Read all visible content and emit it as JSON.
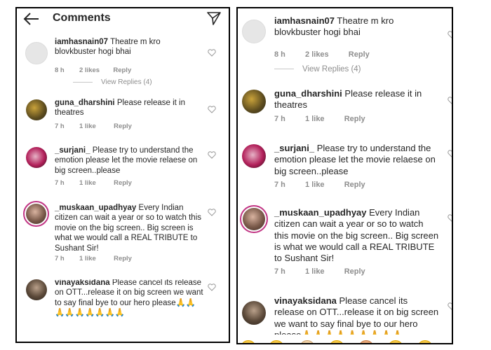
{
  "header": {
    "title": "Comments",
    "back_icon": "back-arrow-icon",
    "send_icon": "send-icon"
  },
  "comments": [
    {
      "user": "iamhasnain07",
      "text": "Theatre m kro blovkbuster hogi bhai",
      "time": "8 h",
      "likes": "2 likes",
      "reply": "Reply"
    },
    {
      "user": "guna_dharshini",
      "text": "Please release it in theatres",
      "time": "7 h",
      "likes": "1 like",
      "reply": "Reply"
    },
    {
      "user": "_surjani_",
      "text": "Please try to understand the emotion please let the movie relaese on big screen..please",
      "time": "7 h",
      "likes": "1 like",
      "reply": "Reply"
    },
    {
      "user": "_muskaan_upadhyay",
      "text": "Every Indian citizen can wait a year or so to watch this movie on the big screen.. Big screen is what we would call a REAL TRIBUTE to Sushant Sir!",
      "time": "7 h",
      "likes": "1 like",
      "reply": "Reply"
    },
    {
      "user": "vinayaksidana",
      "text": "Please cancel its release on OTT...release it on big screen we want to say final bye to our hero please🙏🙏🙏🙏🙏🙏🙏🙏🙏",
      "time": "",
      "likes": "",
      "reply": ""
    }
  ],
  "view_replies": "View Replies (4)",
  "colors": {
    "text": "#262626",
    "muted": "#8e8e8e",
    "story_ring": "#c13584"
  }
}
